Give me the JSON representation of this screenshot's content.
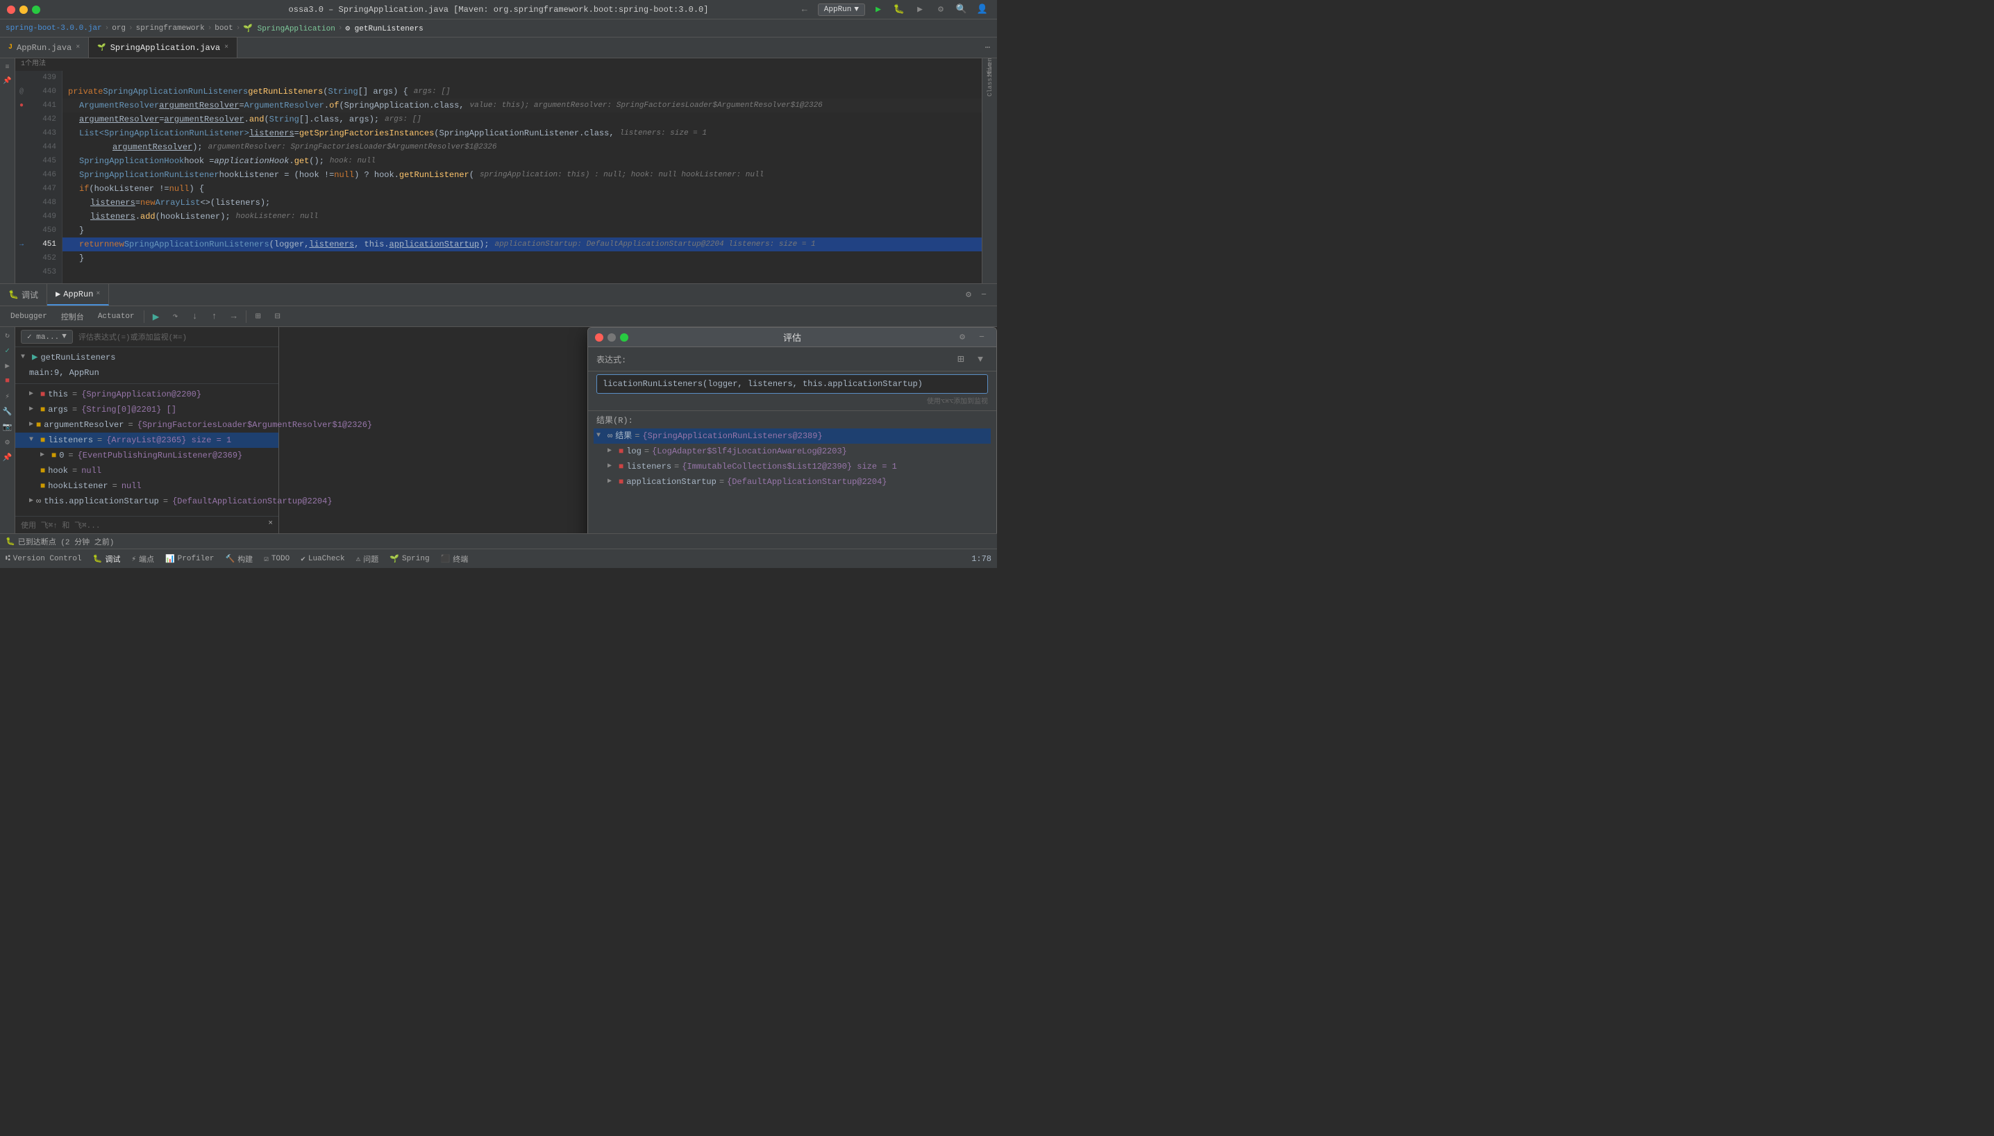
{
  "window": {
    "title": "ossa3.0 – SpringApplication.java [Maven: org.springframework.boot:spring-boot:3.0.0]",
    "traffic_lights": [
      "red",
      "yellow",
      "green"
    ]
  },
  "breadcrumb": {
    "items": [
      "spring-boot-3.0.0.jar",
      "org",
      "springframework",
      "boot",
      "SpringApplication",
      "getRunListeners"
    ]
  },
  "tabs": [
    {
      "label": "AppRun.java",
      "type": "java",
      "active": false
    },
    {
      "label": "SpringApplication.java",
      "type": "spring",
      "active": true
    }
  ],
  "toolbar": {
    "run_config": "AppRun",
    "run_label": "AppRun"
  },
  "code": {
    "usage_hint": "1个用法",
    "lines": [
      {
        "num": 439,
        "content": ""
      },
      {
        "num": 440,
        "code": "private SpringApplicationRunListeners getRunListeners(String[] args) {",
        "hint": "args: []"
      },
      {
        "num": 441,
        "code": "    ArgumentResolver argumentResolver = ArgumentResolver.of(SpringApplication.class,",
        "hint": "value: this);  argumentResolver: SpringFactoriesLoader$ArgumentResolver$1@2326"
      },
      {
        "num": 442,
        "code": "    argumentResolver = argumentResolver.and(String[].class, args);",
        "hint": "args: []"
      },
      {
        "num": 443,
        "code": "    List<SpringApplicationRunListener> listeners = getSpringFactoriesInstances(SpringApplicationRunListener.class,",
        "hint": "listeners:  size = 1"
      },
      {
        "num": 444,
        "code": "            argumentResolver);",
        "hint": "argumentResolver: SpringFactoriesLoader$ArgumentResolver$1@2326"
      },
      {
        "num": 445,
        "code": "    SpringApplicationHook hook = applicationHook.get();",
        "hint": "hook: null"
      },
      {
        "num": 446,
        "code": "    SpringApplicationRunListener hookListener = (hook != null) ? hook.getRunListener(",
        "hint": "springApplication: this) : null;  hook: null  hookListener: null"
      },
      {
        "num": 447,
        "code": "    if (hookListener != null) {"
      },
      {
        "num": 448,
        "code": "        listeners = new ArrayList<>(listeners);"
      },
      {
        "num": 449,
        "code": "        listeners.add(hookListener);",
        "hint": "hookListener: null"
      },
      {
        "num": 450,
        "code": "    }"
      },
      {
        "num": 451,
        "code": "    return new SpringApplicationRunListeners(logger, listeners, this.applicationStartup);",
        "hint": "applicationStartup: DefaultApplicationStartup@2204    listeners: size = 1",
        "highlighted": true
      },
      {
        "num": 452,
        "code": "    }"
      },
      {
        "num": 453,
        "code": ""
      }
    ]
  },
  "debug_panel": {
    "title": "调试",
    "tabs": [
      "调试",
      "AppRun"
    ],
    "active_tab": "AppRun",
    "sub_tabs": [
      "Debugger",
      "控制台",
      "Actuator"
    ],
    "active_sub_tab": "Debugger",
    "filter_label": "ma...",
    "watch_hint": "评估表达式(=)或添加监视(⌘=)",
    "call_stack": [
      {
        "name": "getRunListeners",
        "expand": true
      },
      {
        "name": "main:9, AppRun"
      }
    ],
    "variables": [
      {
        "indent": 1,
        "expand": true,
        "name": "this",
        "value": "{SpringApplication@2200}",
        "icon": "🔴"
      },
      {
        "indent": 1,
        "expand": false,
        "name": "args",
        "value": "{String[0]@2201} []",
        "icon": "🟡"
      },
      {
        "indent": 1,
        "expand": false,
        "name": "argumentResolver",
        "value": "{SpringFactoriesLoader$ArgumentResolver$1@2326}",
        "icon": "🟡",
        "selected": true
      },
      {
        "indent": 1,
        "expand": true,
        "name": "listeners",
        "value": "{ArrayList@2365}  size = 1",
        "icon": "🟡",
        "highlighted": true
      },
      {
        "indent": 2,
        "expand": false,
        "name": "0",
        "value": "{EventPublishingRunListener@2369}",
        "icon": "🟡"
      },
      {
        "indent": 1,
        "name": "hook",
        "value": "null",
        "icon": "🟡"
      },
      {
        "indent": 1,
        "name": "hookListener",
        "value": "null",
        "icon": "🟡"
      },
      {
        "indent": 1,
        "expand": false,
        "name": "this.applicationStartup",
        "value": "{DefaultApplicationStartup@2204}",
        "icon": "∞"
      }
    ]
  },
  "eval_dialog": {
    "title": "评估",
    "label": "表达式:",
    "input_value": "licationRunListeners(logger, listeners, this.applicationStartup)",
    "hint": "使用⌥⌘⌥添加到监视",
    "result_label": "结果(R):",
    "results": [
      {
        "expand": true,
        "name": "∞ 结果",
        "value": "{SpringApplicationRunListeners@2389}",
        "selected": true
      },
      {
        "indent": 1,
        "expand": false,
        "name": "log",
        "value": "{LogAdapter$Slf4jLocationAwareLog@2203}",
        "icon": "🔴"
      },
      {
        "indent": 1,
        "expand": false,
        "name": "listeners",
        "value": "{ImmutableCollections$List12@2390}  size = 1",
        "icon": "🔴"
      },
      {
        "indent": 1,
        "expand": false,
        "name": "applicationStartup",
        "value": "{DefaultApplicationStartup@2204}",
        "icon": "🔴"
      }
    ]
  },
  "status_bar": {
    "debug_status": "已到达断点 (2 分钟 之前)",
    "position": "1:78"
  },
  "bottom_nav": {
    "items": [
      "Version Control",
      "调试",
      "端点",
      "Profiler",
      "构建",
      "TODO",
      "LuaCheck",
      "问题",
      "Spring",
      "终端"
    ]
  }
}
